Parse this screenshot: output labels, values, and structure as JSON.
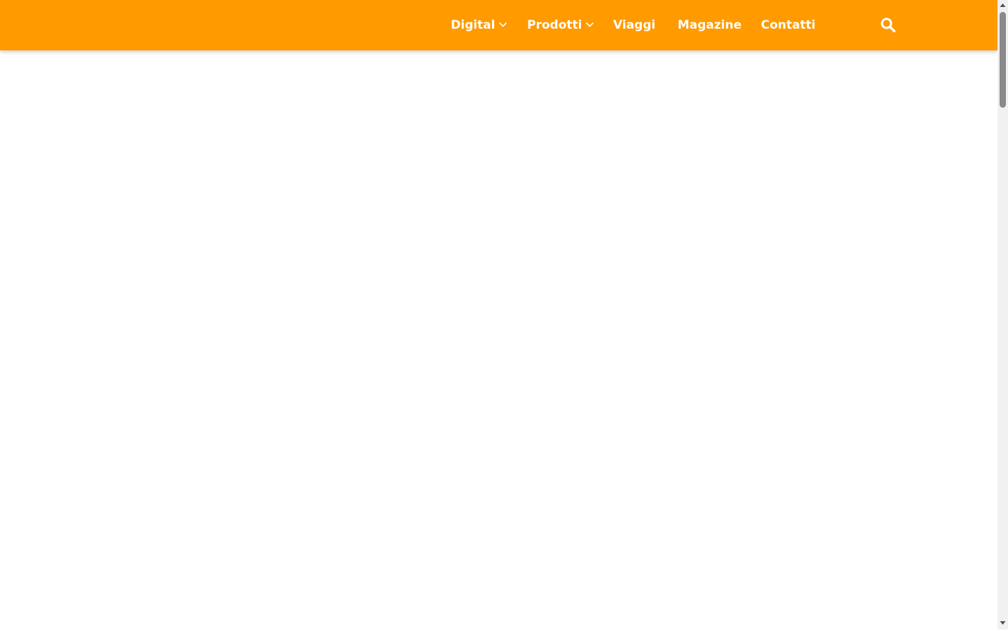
{
  "header": {
    "background_color": "#ff9a00",
    "nav": [
      {
        "label": "Digital",
        "has_dropdown": true
      },
      {
        "label": "Prodotti",
        "has_dropdown": true
      },
      {
        "label": "Viaggi",
        "has_dropdown": false
      },
      {
        "label": "Magazine",
        "has_dropdown": false
      },
      {
        "label": "Contatti",
        "has_dropdown": false
      }
    ],
    "search_icon": "search-icon",
    "dropdown_icon": "chevron-down-icon"
  },
  "scrollbar": {
    "position_fraction": 0.0
  }
}
